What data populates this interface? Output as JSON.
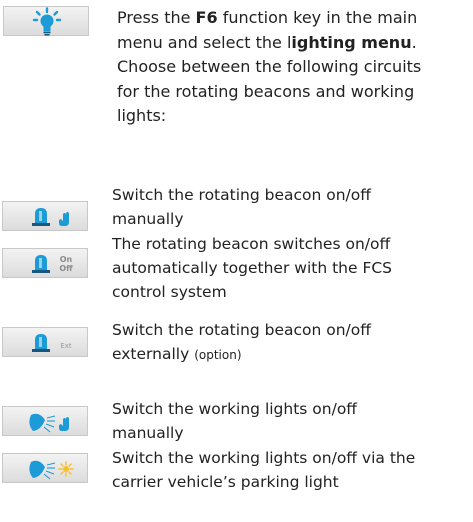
{
  "intro": {
    "p1": "Press the ",
    "key": "F6",
    "p2": " function key in the main",
    "p3": "menu and select the l",
    "menu": "ighting menu",
    "p4": ".",
    "line3": "Choose between the following circuits",
    "line4": "for the rotating beacons and working",
    "line5": "lights:"
  },
  "icons": {
    "lighting": "lightbulb-icon",
    "beacon": "rotating-beacon-icon",
    "worklight": "working-light-icon",
    "hand": "hand-icon",
    "onoff": "on-off-icon",
    "ext": "ext-icon",
    "parking": "parking-light-icon"
  },
  "onoff": {
    "on": "On",
    "off": "Off"
  },
  "ext_label": "Ext",
  "items": [
    {
      "line1": "Switch the rotating beacon on/off",
      "line2": "manually"
    },
    {
      "line1": "The rotating beacon switches on/off",
      "line2": "automatically together with the FCS",
      "line3": "control system"
    },
    {
      "line1": "Switch the rotating beacon on/off",
      "line2": "externally ",
      "option": "(option)"
    },
    {
      "line1": "Switch the working lights on/off",
      "line2": "manually"
    },
    {
      "line1": "Switch the working lights on/off via the",
      "line2": "carrier vehicle’s parking light"
    }
  ],
  "colors": {
    "blue": "#1c9bd7",
    "dark_blue": "#15577e",
    "yellow": "#f6c02a"
  }
}
